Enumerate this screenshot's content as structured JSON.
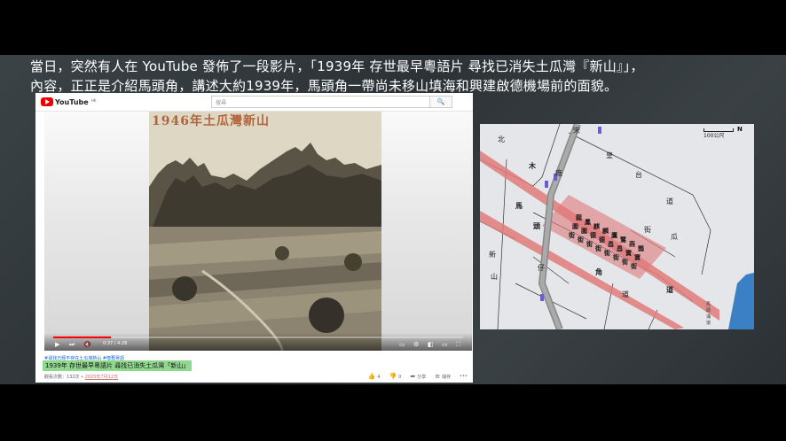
{
  "captions": {
    "line1": "當日，突然有人在 YouTube 發佈了一段影片，「1939年 存世最早粵語片 尋找已消失土瓜灣『新山』」，",
    "line2": "內容，正正是介紹馬頭角，講述大約1939年，馬頭角一帶尚未移山填海和興建啟德機場前的面貌。"
  },
  "youtube": {
    "logo_text": "YouTube",
    "logo_region": "HK",
    "search_placeholder": "搜尋",
    "search_button": "🔍",
    "photo_title": "1946年土瓜灣新山",
    "time": "0:37 / 4:28",
    "progress": 0.14,
    "hashtags": "#尋找已經不存在土瓜灣新山 #懷舊粵語",
    "video_title": "1939年 存世最早粵語片 尋找已消失土瓜灣「新山」",
    "views": "觀看次數：132次",
    "date": "2020年7月12日",
    "likes": "4",
    "dislikes": "0",
    "share": "分享",
    "save": "儲存",
    "more": "•••"
  },
  "map": {
    "scale": "100公尺",
    "north": "N",
    "road_color": "#e07a7a",
    "purple": "#6b5bd6",
    "sea_color": "#3b7fc4",
    "labels": {
      "a": "北",
      "b": "帝",
      "c": "宋",
      "d": "皇",
      "e": "台",
      "f": "道",
      "g": "木",
      "h": "廠",
      "i": "馬",
      "j": "頭",
      "k": "角",
      "l": "道",
      "m": "新",
      "n": "山",
      "o": "道",
      "p": "街",
      "q": "瓜",
      "r": "仔",
      "s1": "譚",
      "s2": "公",
      "s3": "道",
      "s4": "馬",
      "s5": "頭",
      "s6": "涌",
      "s7": "道"
    },
    "streets": [
      "街",
      "街",
      "街",
      "街",
      "街",
      "街",
      "街",
      "街",
      "角"
    ],
    "street_top": [
      "龍",
      "鳳",
      "麒",
      "麟",
      "鷹",
      "鷺",
      "燕",
      "鵲"
    ],
    "street_mid": [
      "圍",
      "圍",
      "德",
      "德",
      "昌",
      "昌",
      "寶",
      "寶"
    ]
  }
}
